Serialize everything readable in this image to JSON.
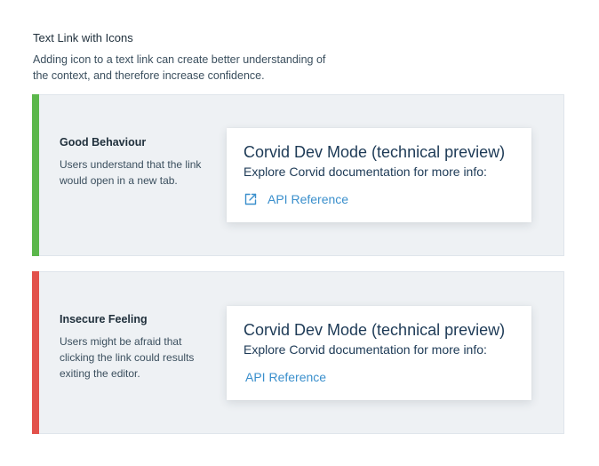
{
  "header": {
    "title": "Text Link with Icons",
    "description": "Adding icon to a text link can create better understanding of the context, and therefore increase confidence."
  },
  "examples": [
    {
      "label": "Good Behaviour",
      "description": "Users understand that the link would open in a new tab.",
      "accent_color": "#5bb74b",
      "card": {
        "title": "Corvid Dev Mode (technical preview)",
        "subtitle": "Explore Corvid documentation for more info:",
        "link_label": "API Reference",
        "link_icon": "external-link-icon"
      }
    },
    {
      "label": "Insecure Feeling",
      "description": "Users might be afraid that clicking the link could results exiting the editor.",
      "accent_color": "#e2514b",
      "card": {
        "title": "Corvid Dev Mode (technical preview)",
        "subtitle": "Explore Corvid documentation for more info:",
        "link_label": "API Reference"
      }
    }
  ],
  "colors": {
    "link": "#3a8fcc",
    "panel_background": "#eef1f4"
  }
}
